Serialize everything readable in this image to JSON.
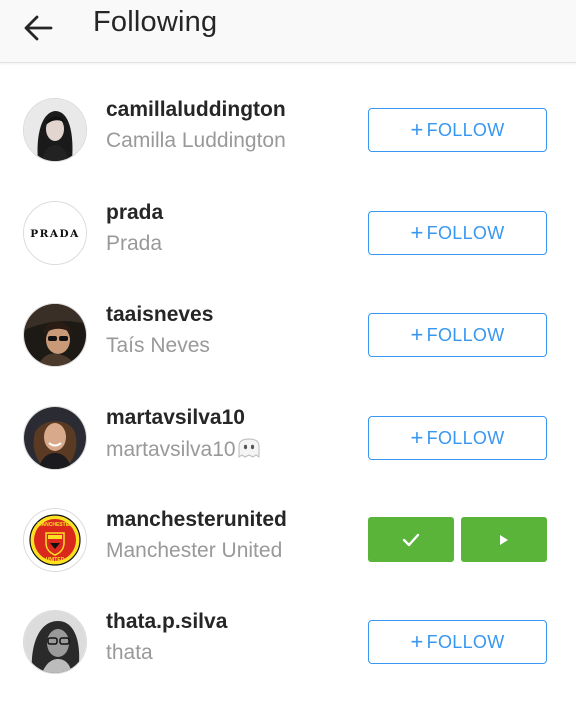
{
  "header": {
    "title": "Following"
  },
  "users": [
    {
      "username": "camillaluddington",
      "full_name": "Camilla Luddington",
      "button": {
        "plus": "+",
        "label": "FOLLOW"
      },
      "avatar": "portrait-dark-hair"
    },
    {
      "username": "prada",
      "full_name": "Prada",
      "button": {
        "plus": "+",
        "label": "FOLLOW"
      },
      "avatar_text": "PRADA"
    },
    {
      "username": "taaisneves",
      "full_name": "Taís Neves",
      "button": {
        "plus": "+",
        "label": "FOLLOW"
      },
      "avatar": "portrait-sunglasses"
    },
    {
      "username": "martavsilva10",
      "full_name": "martavsilva10",
      "full_name_emoji": "ghost-emoji",
      "button": {
        "plus": "+",
        "label": "FOLLOW"
      },
      "avatar": "portrait-smiling"
    },
    {
      "username": "manchesterunited",
      "full_name": "Manchester United",
      "following": true,
      "avatar": "manchester-united-crest",
      "crest_text": {
        "top": "MANCHESTER",
        "bottom": "UNITED"
      }
    },
    {
      "username": "thata.p.silva",
      "full_name": "thata",
      "button": {
        "plus": "+",
        "label": "FOLLOW"
      },
      "avatar": "portrait-glasses"
    }
  ],
  "colors": {
    "accent_blue": "#3897f0",
    "following_green": "#5ab43a",
    "username_text": "#262626",
    "fullname_text": "#999999"
  }
}
